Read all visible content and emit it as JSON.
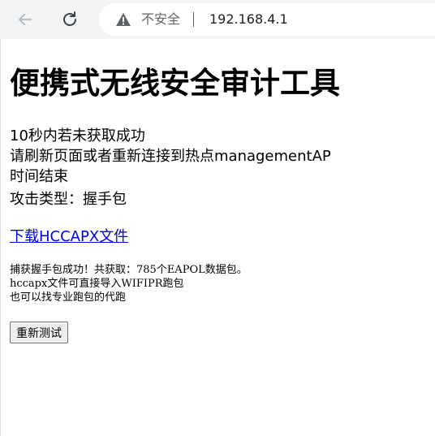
{
  "browser": {
    "security_label": "不安全",
    "url": "192.168.4.1",
    "icons": [
      "back-arrow-icon",
      "reload-icon",
      "warning-icon"
    ]
  },
  "page": {
    "title": "便携式无线安全审计工具",
    "lines": [
      "10秒内若未获取成功",
      "请刷新页面或者重新连接到热点managementAP",
      "时间结束",
      "攻击类型：握手包"
    ],
    "download_link": "下载HCCAPX文件",
    "result_lines": [
      "捕获握手包成功！共获取：785个EAPOL数据包。",
      "hccapx文件可直接导入WIFIPR跑包",
      "也可以找专业跑包的代跑"
    ],
    "retest_button": "重新测试"
  }
}
